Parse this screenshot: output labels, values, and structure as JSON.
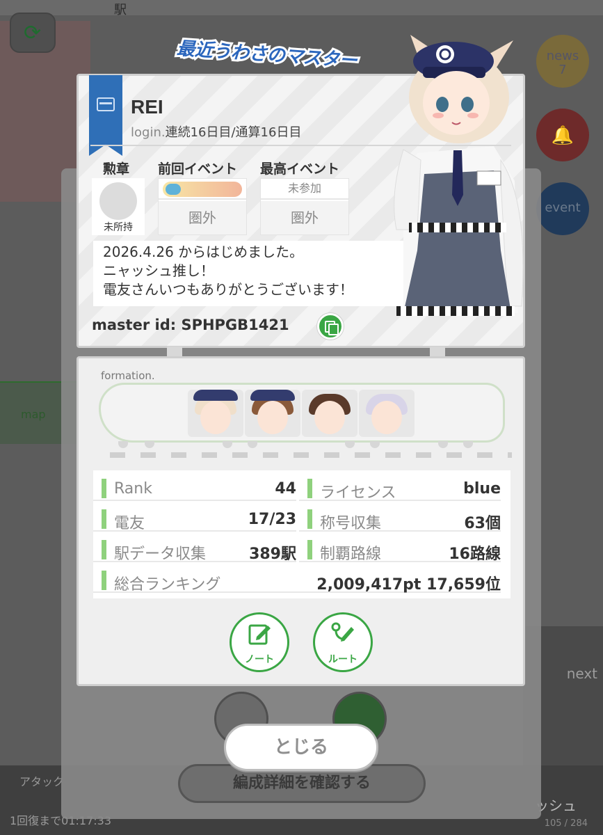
{
  "background": {
    "top_station": "駅",
    "map_label": "map",
    "news_label": "news",
    "news_count": "7",
    "event_label": "event",
    "next_label": "next",
    "attack_label": "アタック",
    "recover_text": "1回復まで01:17:33",
    "sash_label": "ッシュ",
    "counter_text": "105 / 284",
    "detail_button": "編成詳細を確認する"
  },
  "profile": {
    "title_banner": "最近うわさのマスター",
    "username": "REI",
    "login_prefix": "login.",
    "login_text": "連続16日目/通算16日目",
    "medal_label": "勲章",
    "medal_status": "未所持",
    "prev_event_label": "前回イベント",
    "prev_event_result": "圏外",
    "best_event_label": "最高イベント",
    "best_event_name": "未参加",
    "best_event_result": "圏外",
    "comment_lines": [
      "2026.4.26 からはじめました。",
      "ニャッシュ推し！",
      "電友さんいつもありがとうございます！"
    ],
    "master_id": "master id: SPHPGB1421"
  },
  "formation": {
    "label": "formation."
  },
  "stats": {
    "rank_label": "Rank",
    "rank_value": "44",
    "license_label": "ライセンス",
    "license_value": "blue",
    "friends_label": "電友",
    "friends_value": "17/23",
    "titles_label": "称号収集",
    "titles_value": "63個",
    "stations_label": "駅データ収集",
    "stations_value": "389駅",
    "lines_label": "制覇路線",
    "lines_value": "16路線",
    "ranking_label": "総合ランキング",
    "ranking_value": "2,009,417pt 17,659位"
  },
  "buttons": {
    "note": "ノート",
    "route": "ルート",
    "close": "とじる"
  },
  "colors": {
    "accent_green": "#3aa644",
    "ribbon_blue": "#2f6fb7",
    "stat_bar": "#8fd17d"
  }
}
